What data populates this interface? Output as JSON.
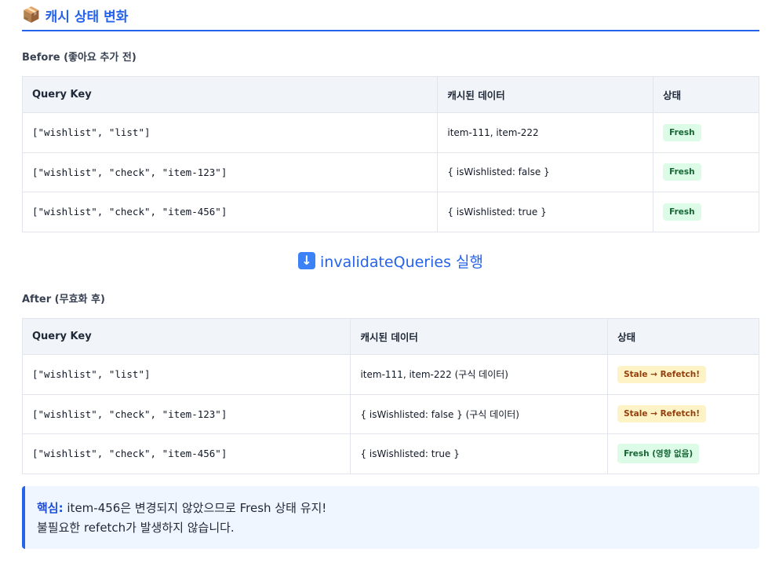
{
  "title": {
    "icon": "package-icon",
    "text": "캐시 상태 변화"
  },
  "before": {
    "label": "Before (좋아요 추가 전)",
    "headers": [
      "Query Key",
      "캐시된 데이터",
      "상태"
    ],
    "rows": [
      {
        "key": "[\"wishlist\", \"list\"]",
        "data": "item-111, item-222",
        "status": "Fresh",
        "status_type": "fresh"
      },
      {
        "key": "[\"wishlist\", \"check\", \"item-123\"]",
        "data": "{ isWishlisted: false }",
        "status": "Fresh",
        "status_type": "fresh"
      },
      {
        "key": "[\"wishlist\", \"check\", \"item-456\"]",
        "data": "{ isWishlisted: true }",
        "status": "Fresh",
        "status_type": "fresh"
      }
    ]
  },
  "divider": {
    "icon": "down-arrow-icon",
    "text": "invalidateQueries 실행"
  },
  "after": {
    "label": "After (무효화 후)",
    "headers": [
      "Query Key",
      "캐시된 데이터",
      "상태"
    ],
    "rows": [
      {
        "key": "[\"wishlist\", \"list\"]",
        "data": "item-111, item-222 (구식 데이터)",
        "status": "Stale → Refetch!",
        "status_type": "stale"
      },
      {
        "key": "[\"wishlist\", \"check\", \"item-123\"]",
        "data": "{ isWishlisted: false } (구식 데이터)",
        "status": "Stale → Refetch!",
        "status_type": "stale"
      },
      {
        "key": "[\"wishlist\", \"check\", \"item-456\"]",
        "data": "{ isWishlisted: true }",
        "status": "Fresh (영향 없음)",
        "status_type": "fresh"
      }
    ]
  },
  "note": {
    "label": "핵심:",
    "line1": "item-456은 변경되지 않았으므로 Fresh 상태 유지!",
    "line2": "불필요한 refetch가 발생하지 않습니다."
  },
  "colors": {
    "accent": "#2563eb",
    "fresh_bg": "#dcfce7",
    "fresh_text": "#166534",
    "stale_bg": "#fef3c7",
    "stale_text": "#92400e"
  }
}
